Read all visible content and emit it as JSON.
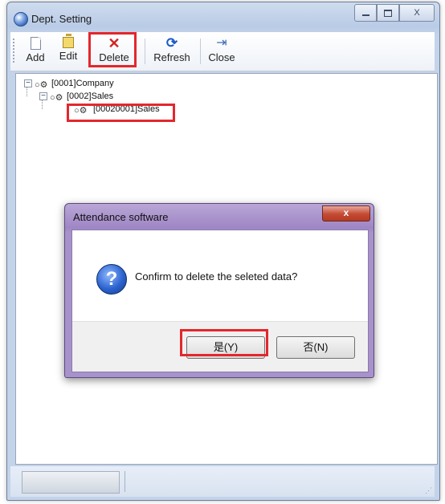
{
  "window": {
    "title": "Dept. Setting",
    "controls": {
      "minimize": "",
      "maximize": "",
      "close": "X"
    }
  },
  "toolbar": {
    "items": [
      {
        "label": "Add",
        "icon": "new-document-icon"
      },
      {
        "label": "Edit",
        "icon": "folder-edit-icon"
      },
      {
        "label": "Delete",
        "icon": "delete-x-icon"
      },
      {
        "label": "Refresh",
        "icon": "refresh-icon"
      },
      {
        "label": "Close",
        "icon": "door-exit-icon"
      }
    ]
  },
  "tree": {
    "nodes": [
      {
        "label": "[0001]Company",
        "expander": "−"
      },
      {
        "label": "[0002]Sales",
        "expander": "−"
      },
      {
        "label": "[00020001]Sales"
      }
    ]
  },
  "dialog": {
    "title": "Attendance software",
    "close": "x",
    "message": "Confirm to delete the seleted data?",
    "icon": "question-icon",
    "yes_label": "是(Y)",
    "no_label": "否(N)"
  },
  "colors": {
    "highlight": "#e3272d",
    "dialog_frame": "#a892cb",
    "window_frame": "#c3d3ea"
  }
}
